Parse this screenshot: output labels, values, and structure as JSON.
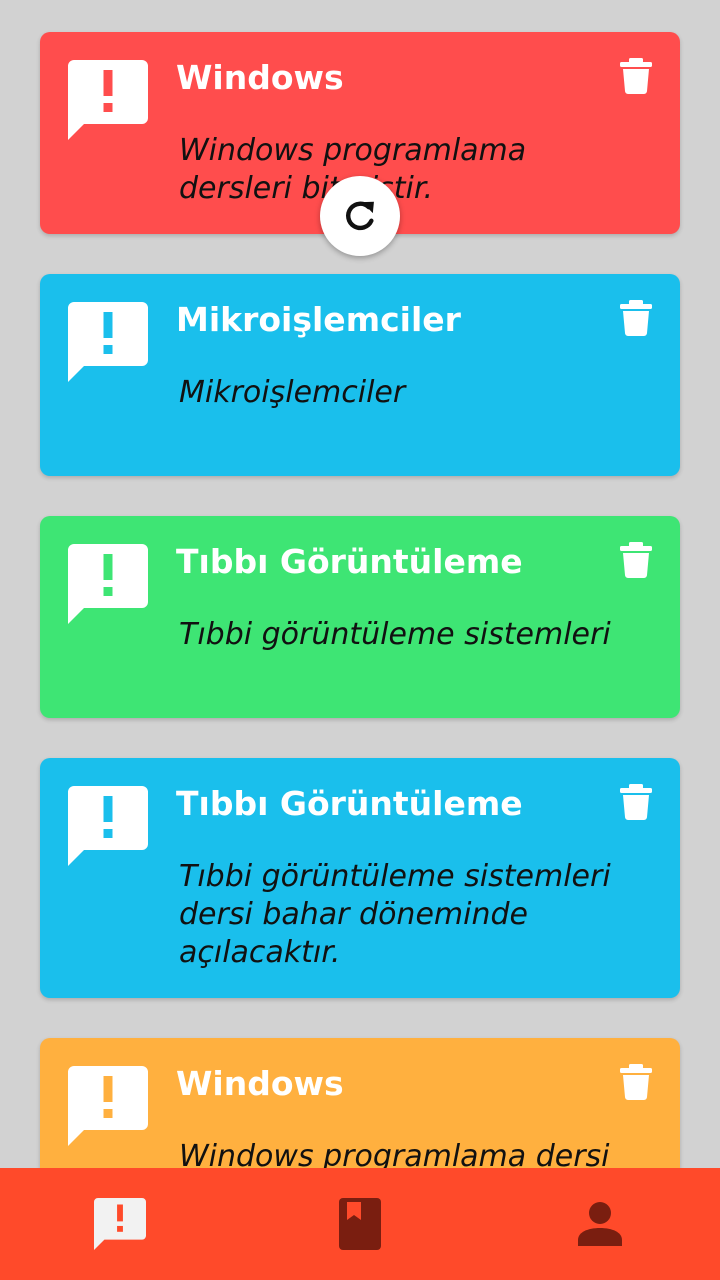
{
  "colors": {
    "card_red": "#ff4d4d",
    "card_blue": "#1abfec",
    "card_green": "#3ee574",
    "card_orange": "#ffb03f",
    "nav_background": "#ff4a2a",
    "nav_active_icon": "#f2f2f2",
    "nav_inactive_icon": "#7a1e10"
  },
  "announcements": [
    {
      "title": "Windows",
      "body": "Windows programlama dersleri bitmiştir.",
      "color": "#ff4d4d",
      "icon": "alert-bubble-icon"
    },
    {
      "title": "Mikroişlemciler",
      "body": "Mikroişlemciler",
      "color": "#1abfec",
      "icon": "alert-bubble-icon"
    },
    {
      "title": "Tıbbı Görüntüleme",
      "body": "Tıbbi görüntüleme sistemleri",
      "color": "#3ee574",
      "icon": "alert-bubble-icon"
    },
    {
      "title": "Tıbbı Görüntüleme",
      "body": "Tıbbi görüntüleme sistemleri dersi bahar döneminde açılacaktır.",
      "color": "#1abfec",
      "icon": "alert-bubble-icon"
    },
    {
      "title": "Windows",
      "body": "Windows programlama dersi",
      "color": "#ffb03f",
      "icon": "alert-bubble-icon"
    }
  ],
  "refresh": {
    "icon": "refresh-icon"
  },
  "bottom_nav": [
    {
      "icon": "announcements-icon",
      "active": true
    },
    {
      "icon": "book-icon",
      "active": false
    },
    {
      "icon": "profile-icon",
      "active": false
    }
  ]
}
